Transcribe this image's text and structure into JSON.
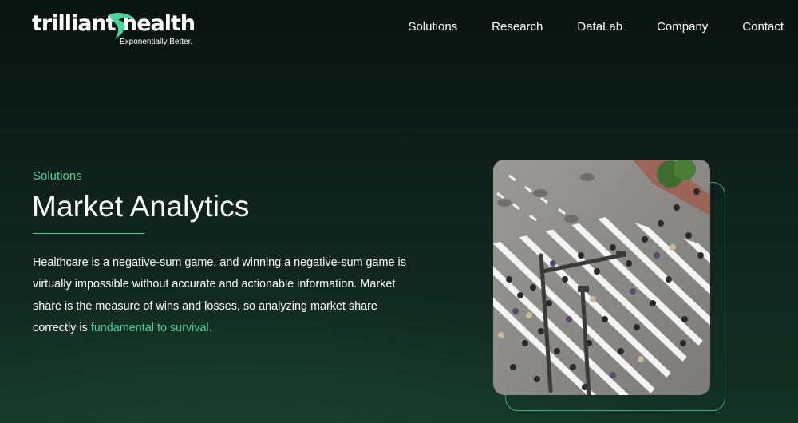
{
  "brand": {
    "name": "trilliant health",
    "tagline": "Exponentially Better.",
    "accent_color": "#4fd39a"
  },
  "nav": {
    "items": [
      {
        "label": "Solutions"
      },
      {
        "label": "Research"
      },
      {
        "label": "DataLab"
      },
      {
        "label": "Company"
      },
      {
        "label": "Contact"
      }
    ]
  },
  "hero": {
    "eyebrow": "Solutions",
    "title": "Market Analytics",
    "body": "Healthcare is a negative-sum game, and winning a negative-sum game is virtually impossible without accurate and actionable information. Market share is the measure of wins and losses, so analyzing market share correctly is ",
    "link_text": "fundamental to survival.",
    "image_icon": "crosswalk-crowd-photo"
  }
}
